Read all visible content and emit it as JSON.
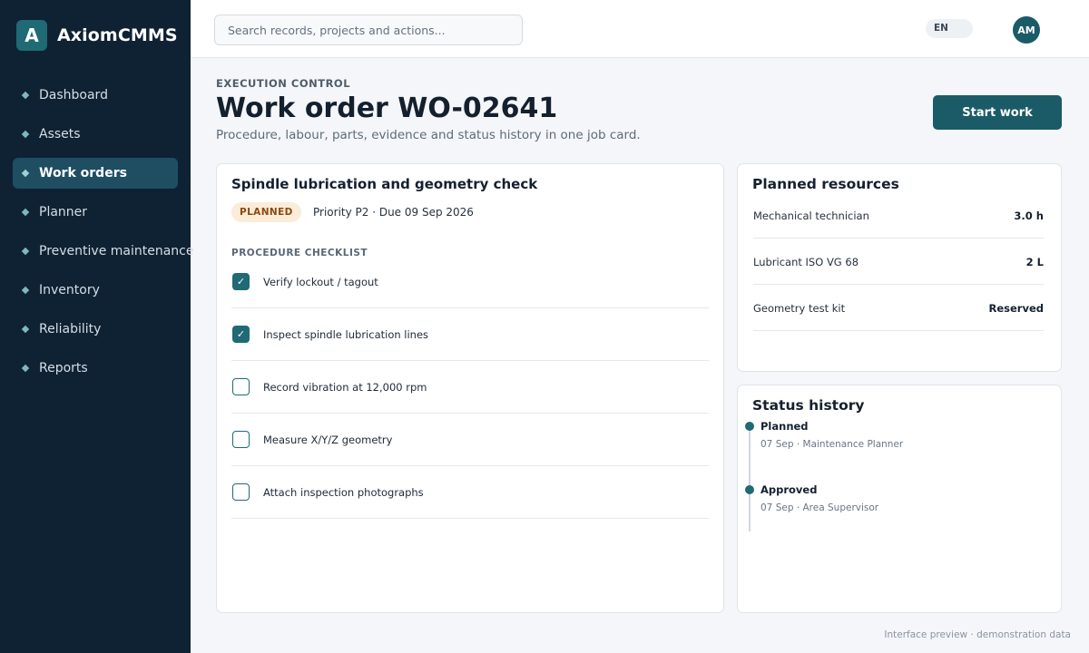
{
  "brand": {
    "mark": "A",
    "name": "AxiomCMMS"
  },
  "nav": [
    {
      "label": "Dashboard",
      "active": false
    },
    {
      "label": "Assets",
      "active": false
    },
    {
      "label": "Work orders",
      "active": true
    },
    {
      "label": "Planner",
      "active": false
    },
    {
      "label": "Preventive maintenance",
      "active": false
    },
    {
      "label": "Inventory",
      "active": false
    },
    {
      "label": "Reliability",
      "active": false
    },
    {
      "label": "Reports",
      "active": false
    }
  ],
  "topbar": {
    "search_placeholder": "Search records, projects and actions...",
    "language": "EN",
    "avatar_initials": "AM"
  },
  "header": {
    "eyebrow": "EXECUTION CONTROL",
    "title": "Work order WO-02641",
    "subtitle": "Procedure, labour, parts, evidence and status history in one job card.",
    "primary_action": "Start work"
  },
  "job": {
    "title": "Spindle lubrication and geometry check",
    "status": "PLANNED",
    "meta": "Priority P2 · Due 09 Sep 2026",
    "checklist_label": "PROCEDURE CHECKLIST",
    "checklist": [
      {
        "label": "Verify lockout / tagout",
        "checked": true
      },
      {
        "label": "Inspect spindle lubrication lines",
        "checked": true
      },
      {
        "label": "Record vibration at 12,000 rpm",
        "checked": false
      },
      {
        "label": "Measure X/Y/Z geometry",
        "checked": false
      },
      {
        "label": "Attach inspection photographs",
        "checked": false
      }
    ]
  },
  "resources": {
    "title": "Planned resources",
    "items": [
      {
        "name": "Mechanical technician",
        "qty": "3.0 h"
      },
      {
        "name": "Lubricant ISO VG 68",
        "qty": "2 L"
      },
      {
        "name": "Geometry test kit",
        "qty": "Reserved"
      }
    ]
  },
  "history": {
    "title": "Status history",
    "items": [
      {
        "status": "Planned",
        "detail": "07 Sep · Maintenance Planner"
      },
      {
        "status": "Approved",
        "detail": "07 Sep · Area Supervisor"
      }
    ]
  },
  "footer": "Interface preview · demonstration data",
  "colors": {
    "sidebar": "#0e2233",
    "accent": "#1a5b67",
    "badge_bg": "#fbecd9",
    "badge_text": "#8a4a10"
  }
}
